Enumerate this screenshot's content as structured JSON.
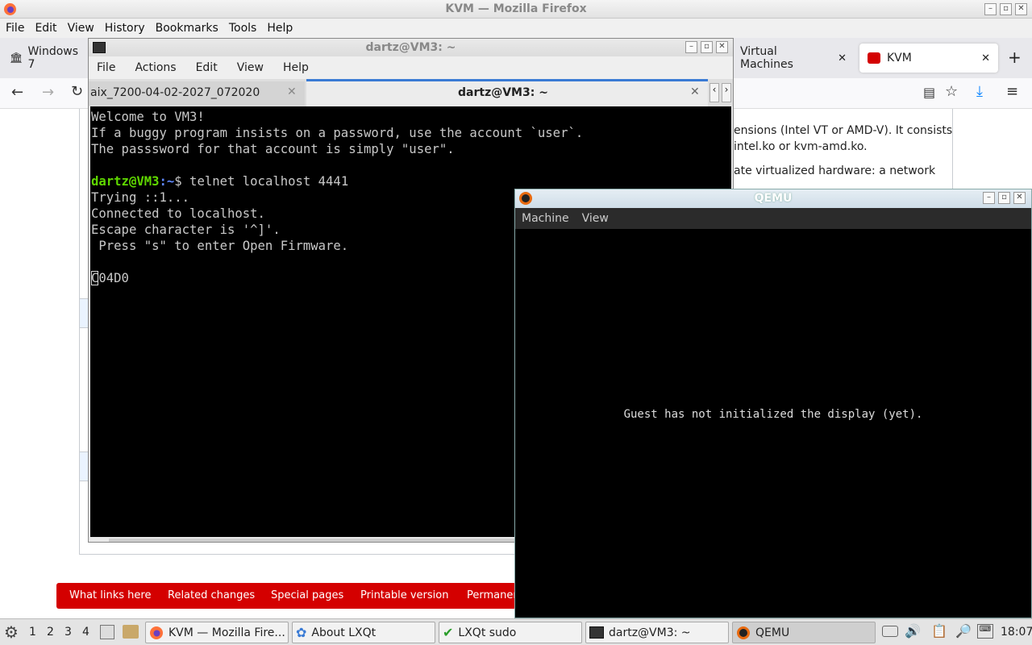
{
  "firefox": {
    "window_title": "KVM — Mozilla Firefox",
    "menu": [
      "File",
      "Edit",
      "View",
      "History",
      "Bookmarks",
      "Tools",
      "Help"
    ],
    "tabs": [
      {
        "label": "Windows 7"
      },
      {
        "label": "Virtual Machines"
      },
      {
        "label": "KVM"
      }
    ],
    "new_tab": "+",
    "page_text": [
      "ensions (Intel VT or AMD-V). It consists",
      "intel.ko or kvm-amd.ko.",
      "ate virtualized hardware: a network"
    ],
    "footer_links": [
      "What links here",
      "Related changes",
      "Special pages",
      "Printable version",
      "Permanen"
    ]
  },
  "terminal": {
    "window_title": "dartz@VM3: ~",
    "menu": [
      "File",
      "Actions",
      "Edit",
      "View",
      "Help"
    ],
    "tabs": [
      {
        "label": "aix_7200-04-02-2027_072020"
      },
      {
        "label": "dartz@VM3: ~"
      }
    ],
    "lines": [
      "Welcome to VM3!",
      "If a buggy program insists on a password, use the account `user`.",
      "The passsword for that account is simply \"user\"."
    ],
    "prompt_user": "dartz@VM3",
    "prompt_path": ":~",
    "prompt_cmd": "$ telnet localhost 4441",
    "output": [
      "Trying ::1...",
      "Connected to localhost.",
      "Escape character is '^]'.",
      " Press \"s\" to enter Open Firmware."
    ],
    "cursor_line": "C04D0"
  },
  "qemu": {
    "window_title": "QEMU",
    "menu": [
      "Machine",
      "View"
    ],
    "message": "Guest has not initialized the display (yet)."
  },
  "taskbar": {
    "desktops": [
      "1",
      "2",
      "3",
      "4"
    ],
    "tasks": [
      {
        "label": "KVM — Mozilla Fire..."
      },
      {
        "label": "About LXQt"
      },
      {
        "label": "LXQt sudo"
      },
      {
        "label": "dartz@VM3: ~"
      },
      {
        "label": "QEMU"
      }
    ],
    "clock": "18:07"
  },
  "colors": {
    "prompt_green": "#5fd700",
    "prompt_blue": "#5f87ff",
    "footer_red": "#d40000",
    "terminal_bg": "#000000"
  }
}
